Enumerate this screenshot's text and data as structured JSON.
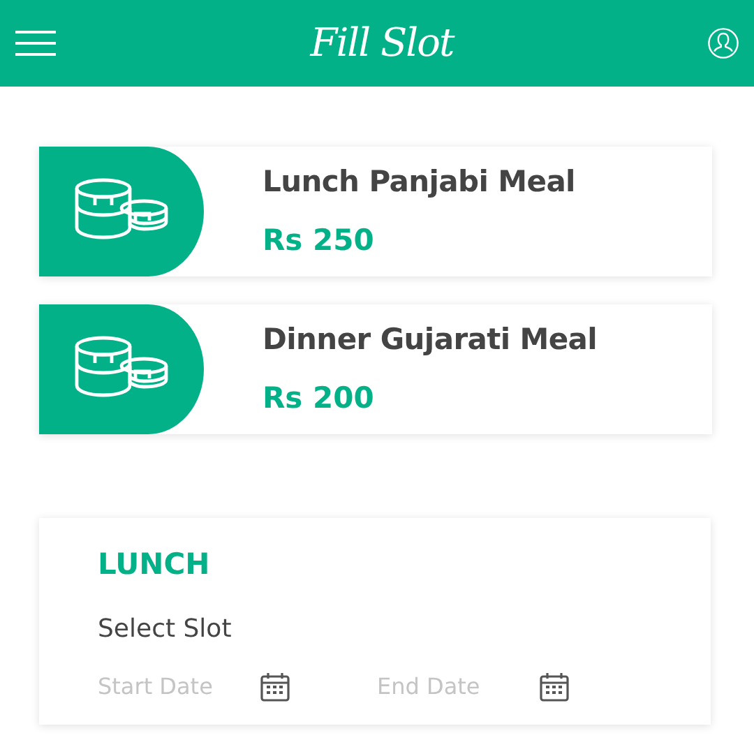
{
  "header": {
    "title": "Fill Slot"
  },
  "meals": [
    {
      "name": "Lunch Panjabi Meal",
      "price": "Rs 250"
    },
    {
      "name": "Dinner Gujarati Meal",
      "price": "Rs 200"
    }
  ],
  "slot_panel": {
    "heading": "LUNCH",
    "label": "Select Slot",
    "start_date": {
      "placeholder": "Start Date"
    },
    "end_date": {
      "placeholder": "End Date"
    }
  }
}
